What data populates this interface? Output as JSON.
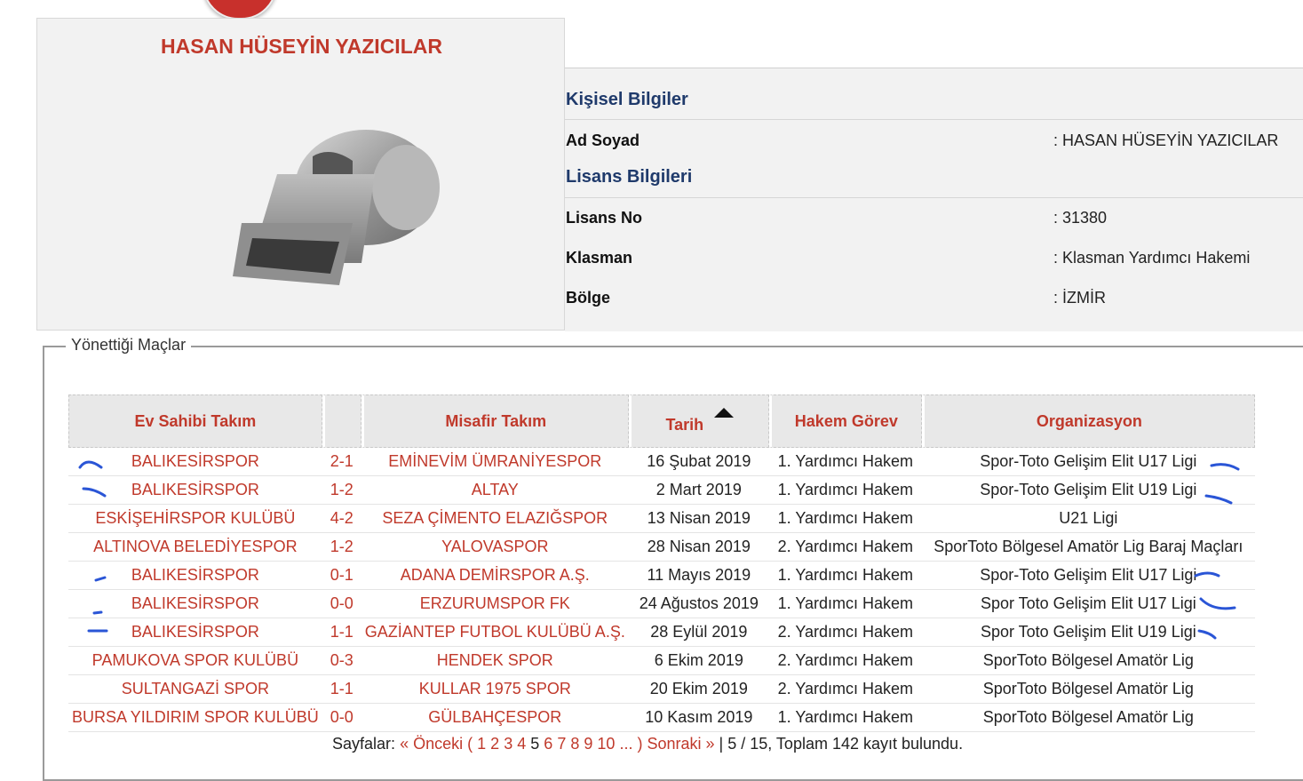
{
  "profile": {
    "name": "HASAN HÜSEYİN YAZICILAR"
  },
  "personal": {
    "title": "Kişisel Bilgiler",
    "rows": [
      {
        "label": "Ad Soyad",
        "value": ": HASAN HÜSEYİN YAZICILAR"
      }
    ]
  },
  "license": {
    "title": "Lisans Bilgileri",
    "rows": [
      {
        "label": "Lisans No",
        "value": ": 31380"
      },
      {
        "label": "Klasman",
        "value": ": Klasman Yardımcı Hakemi"
      },
      {
        "label": "Bölge",
        "value": ": İZMİR"
      }
    ]
  },
  "matches": {
    "legend": "Yönettiği Maçlar",
    "headers": [
      "Ev Sahibi Takım",
      "",
      "Misafir Takım",
      "Tarih",
      "Hakem Görev",
      "Organizasyon"
    ],
    "rows": [
      [
        "BALIKESİRSPOR",
        "2-1",
        "EMİNEVİM ÜMRANİYESPOR",
        "16 Şubat 2019",
        "1. Yardımcı Hakem",
        "Spor-Toto Gelişim Elit U17 Ligi"
      ],
      [
        "BALIKESİRSPOR",
        "1-2",
        "ALTAY",
        "2 Mart 2019",
        "1. Yardımcı Hakem",
        "Spor-Toto Gelişim Elit U19 Ligi"
      ],
      [
        "ESKİŞEHİRSPOR KULÜBÜ",
        "4-2",
        "SEZA ÇİMENTO ELAZIĞSPOR",
        "13 Nisan 2019",
        "1. Yardımcı Hakem",
        "U21 Ligi"
      ],
      [
        "ALTINOVA BELEDİYESPOR",
        "1-2",
        "YALOVASPOR",
        "28 Nisan 2019",
        "2. Yardımcı Hakem",
        "SporToto Bölgesel Amatör Lig Baraj Maçları"
      ],
      [
        "BALIKESİRSPOR",
        "0-1",
        "ADANA DEMİRSPOR A.Ş.",
        "11 Mayıs 2019",
        "1. Yardımcı Hakem",
        "Spor-Toto Gelişim Elit U17 Ligi"
      ],
      [
        "BALIKESİRSPOR",
        "0-0",
        "ERZURUMSPOR FK",
        "24 Ağustos 2019",
        "1. Yardımcı Hakem",
        "Spor Toto Gelişim Elit U17 Ligi"
      ],
      [
        "BALIKESİRSPOR",
        "1-1",
        "GAZİANTEP FUTBOL KULÜBÜ A.Ş.",
        "28 Eylül 2019",
        "2. Yardımcı Hakem",
        "Spor Toto Gelişim Elit U19 Ligi"
      ],
      [
        "PAMUKOVA SPOR KULÜBÜ",
        "0-3",
        "HENDEK SPOR",
        "6 Ekim 2019",
        "2. Yardımcı Hakem",
        "SporToto Bölgesel Amatör Lig"
      ],
      [
        "SULTANGAZİ SPOR",
        "1-1",
        "KULLAR 1975 SPOR",
        "20 Ekim 2019",
        "2. Yardımcı Hakem",
        "SporToto Bölgesel Amatör Lig"
      ],
      [
        "BURSA YILDIRIM SPOR KULÜBÜ",
        "0-0",
        "GÜLBAHÇESPOR",
        "10 Kasım 2019",
        "1. Yardımcı Hakem",
        "SporToto Bölgesel Amatör Lig"
      ]
    ]
  },
  "pager": {
    "label": "Sayfalar:",
    "prev": "« Önceki",
    "open": "(",
    "pages_before": [
      "1",
      "2",
      "3",
      "4"
    ],
    "current": "5",
    "pages_after": [
      "6",
      "7",
      "8",
      "9",
      "10"
    ],
    "ellipsis": "... )",
    "next": "Sonraki »",
    "summary": "| 5 / 15, Toplam 142 kayıt bulundu."
  },
  "colors": {
    "accent": "#c0392b",
    "heading": "#1f3a6b",
    "annotation": "#2a55d6"
  }
}
